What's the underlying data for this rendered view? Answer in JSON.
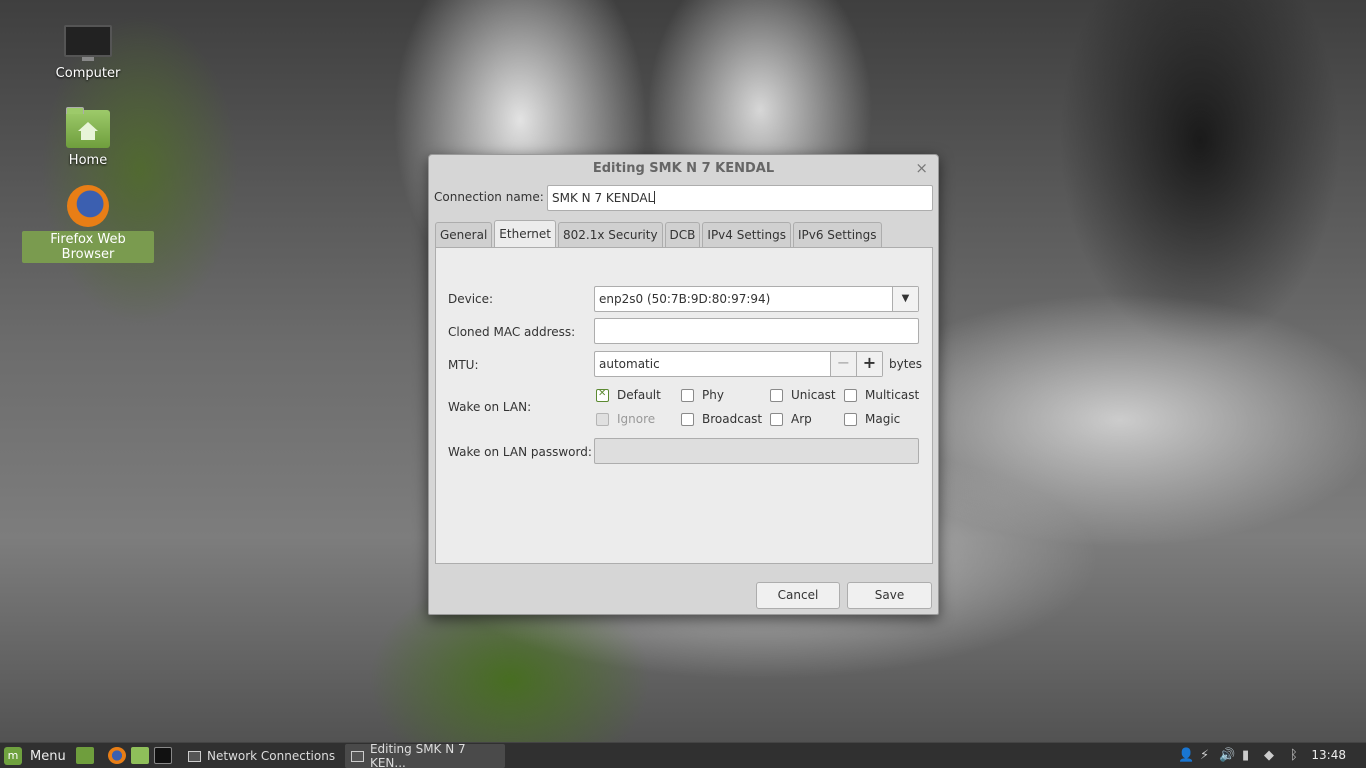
{
  "desktop": {
    "icons": [
      {
        "label": "Computer",
        "icon": "computer-icon"
      },
      {
        "label": "Home",
        "icon": "home-folder-icon"
      },
      {
        "label": "Firefox Web Browser",
        "icon": "firefox-icon"
      }
    ]
  },
  "dialog": {
    "title": "Editing SMK N 7 KENDAL",
    "close_glyph": "×",
    "connection_name_label": "Connection name:",
    "connection_name_value": "SMK N 7 KENDAL",
    "tabs": [
      {
        "label": "General",
        "active": false
      },
      {
        "label": "Ethernet",
        "active": true
      },
      {
        "label": "802.1x Security",
        "active": false
      },
      {
        "label": "DCB",
        "active": false
      },
      {
        "label": "IPv4 Settings",
        "active": false
      },
      {
        "label": "IPv6 Settings",
        "active": false
      }
    ],
    "device_label": "Device:",
    "device_value": "enp2s0 (50:7B:9D:80:97:94)",
    "cloned_mac_label": "Cloned MAC address:",
    "cloned_mac_value": "",
    "mtu_label": "MTU:",
    "mtu_value": "automatic",
    "mtu_unit": "bytes",
    "wol_label": "Wake on LAN:",
    "wol_options": [
      {
        "label": "Default",
        "checked": true,
        "enabled": true
      },
      {
        "label": "Phy",
        "checked": false,
        "enabled": true
      },
      {
        "label": "Unicast",
        "checked": false,
        "enabled": true
      },
      {
        "label": "Multicast",
        "checked": false,
        "enabled": true
      },
      {
        "label": "Ignore",
        "checked": false,
        "enabled": false
      },
      {
        "label": "Broadcast",
        "checked": false,
        "enabled": true
      },
      {
        "label": "Arp",
        "checked": false,
        "enabled": true
      },
      {
        "label": "Magic",
        "checked": false,
        "enabled": true
      }
    ],
    "wol_password_label": "Wake on LAN password:",
    "wol_password_value": "",
    "cancel_label": "Cancel",
    "save_label": "Save"
  },
  "taskbar": {
    "menu_label": "Menu",
    "windows": [
      {
        "label": "Network Connections",
        "active": false
      },
      {
        "label": "Editing SMK N 7 KEN...",
        "active": true
      }
    ],
    "clock": "13:48"
  },
  "colors": {
    "accent": "#7a9b4f",
    "checkbox_checked": "#5c8a32",
    "taskbar_bg": "#303030"
  }
}
